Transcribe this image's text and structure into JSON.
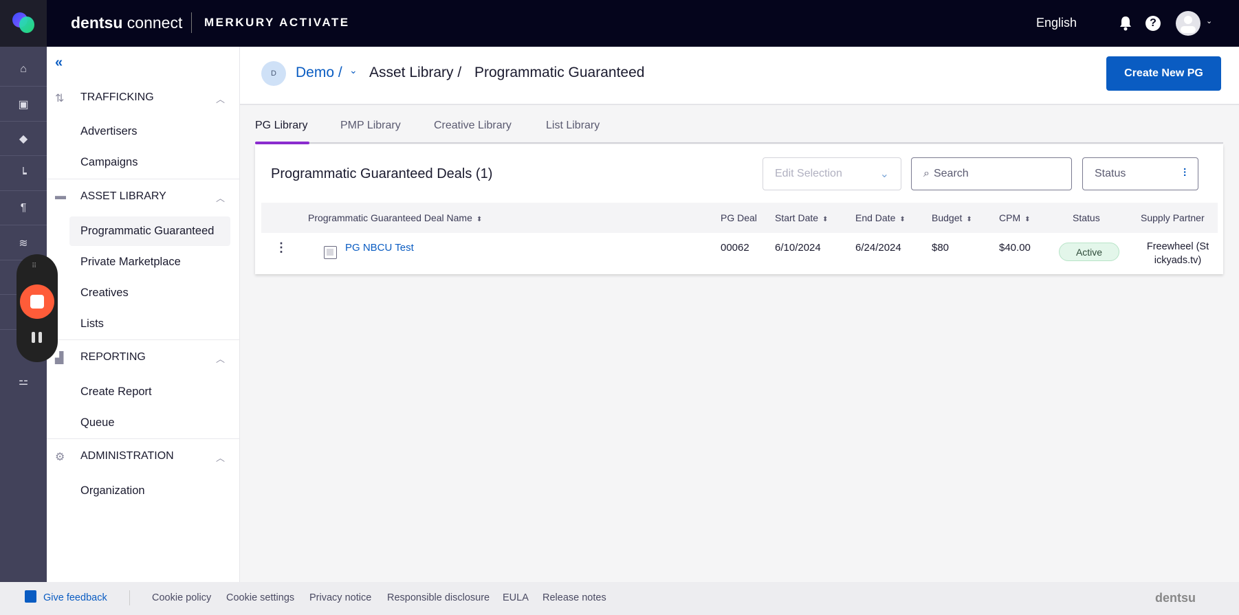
{
  "topbar": {
    "brand_bold": "dentsu",
    "brand_light": " connect",
    "product": "MERKURY ACTIVATE",
    "language": "English"
  },
  "rail": {
    "icons": [
      "home-icon",
      "box-icon",
      "graduation-cap-icon",
      "chart-step-icon",
      "paragraph-icon",
      "layers-icon",
      "filter-icon"
    ]
  },
  "sidebar": {
    "collapse": "«",
    "sections": [
      {
        "title": "TRAFFICKING",
        "items": [
          "Advertisers",
          "Campaigns"
        ]
      },
      {
        "title": "ASSET LIBRARY",
        "items": [
          "Programmatic Guaranteed",
          "Private Marketplace",
          "Creatives",
          "Lists"
        ]
      },
      {
        "title": "REPORTING",
        "items": [
          "Create Report",
          "Queue"
        ]
      },
      {
        "title": "ADMINISTRATION",
        "items": [
          "Organization"
        ]
      }
    ]
  },
  "header": {
    "avatar": "D",
    "workspace": "Demo /",
    "crumb1": "Asset Library /",
    "crumb2": "Programmatic Guaranteed",
    "create_button": "Create New PG"
  },
  "tabs": [
    "PG Library",
    "PMP Library",
    "Creative Library",
    "List Library"
  ],
  "card": {
    "title": "Programmatic Guaranteed Deals (1)",
    "edit_selection": "Edit Selection",
    "search_placeholder": "Search",
    "status_filter": "Status",
    "columns": [
      "Programmatic Guaranteed Deal Name",
      "PG Deal",
      "Start Date",
      "End Date",
      "Budget",
      "CPM",
      "Status",
      "Supply Partner"
    ],
    "rows": [
      {
        "name": "PG NBCU Test",
        "pg_deal": "00062",
        "start": "6/10/2024",
        "end": "6/24/2024",
        "budget": "$80",
        "cpm": "$40.00",
        "status": "Active",
        "partner1": "Freewheel (St",
        "partner2": "ickyads.tv)"
      }
    ]
  },
  "footer": {
    "feedback": "Give feedback",
    "links": [
      "Cookie policy",
      "Cookie settings",
      "Privacy notice",
      "Responsible disclosure",
      "EULA",
      "Release notes"
    ],
    "logo": "dentsu"
  },
  "colors": {
    "accent": "#0a5cc2",
    "tab_active": "#8b2ccf",
    "topbar": "#05051c",
    "rail": "#42425a",
    "record": "#ff5c39"
  }
}
